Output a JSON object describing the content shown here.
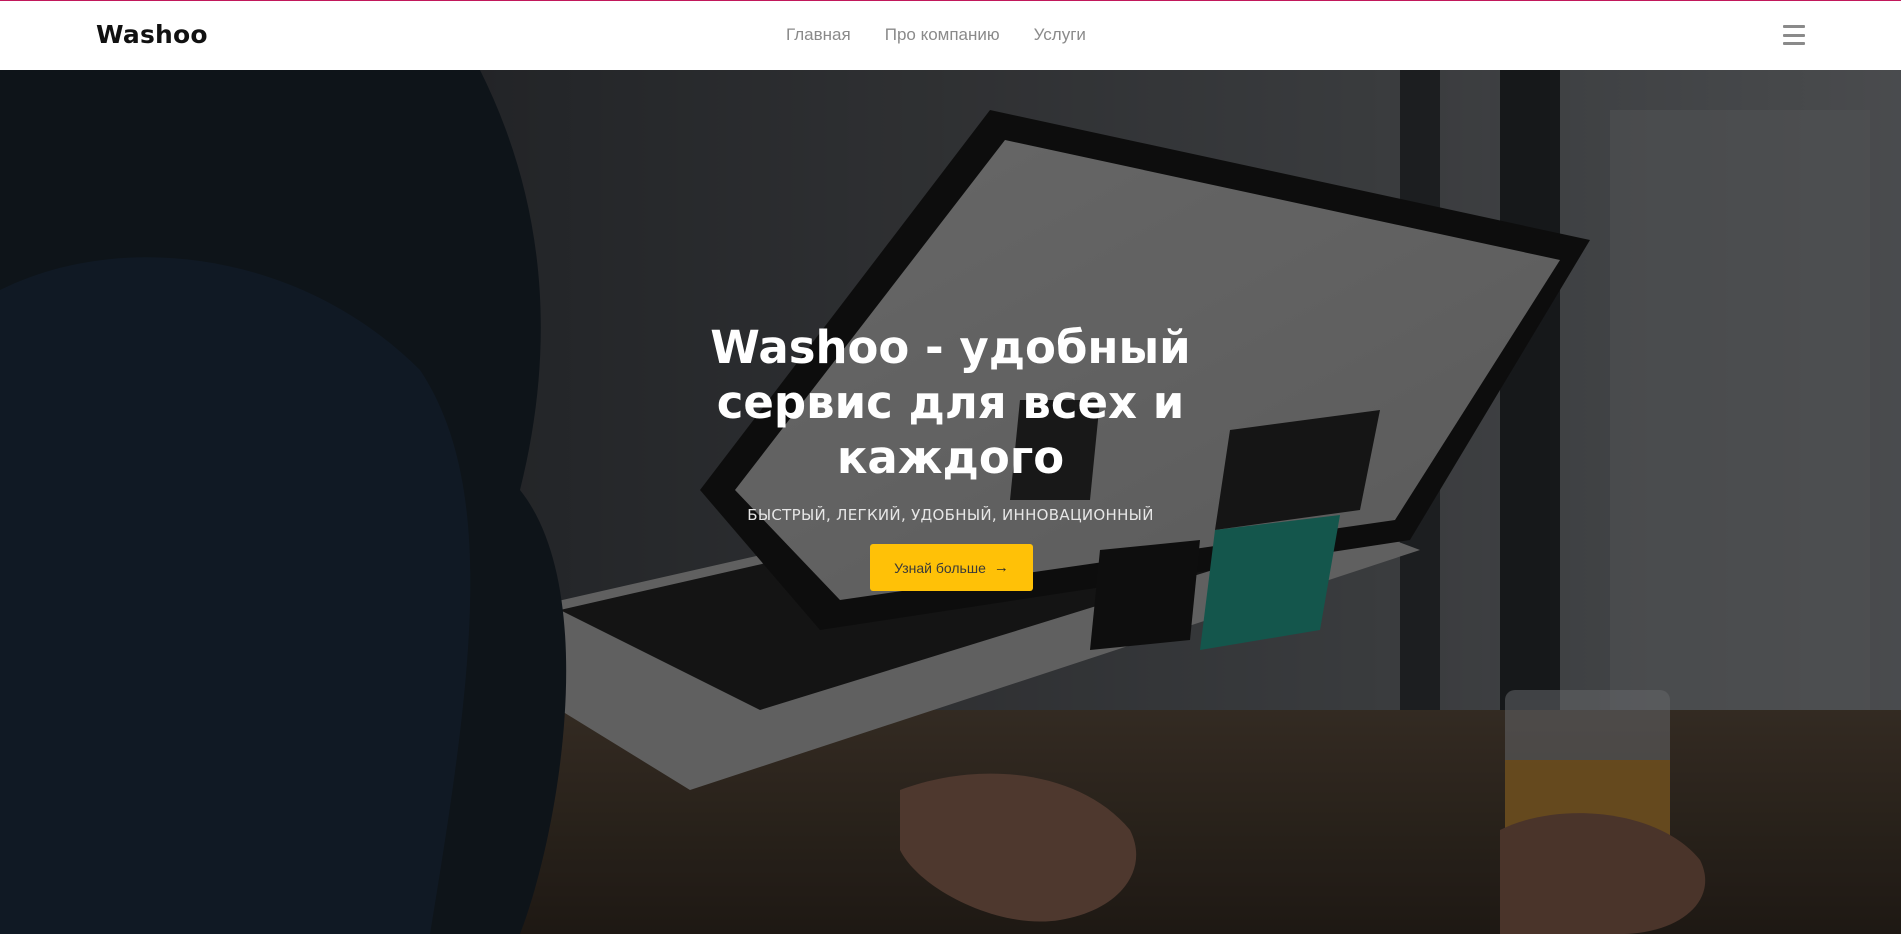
{
  "navbar": {
    "brand": "Washoo",
    "links": [
      {
        "label": "Главная"
      },
      {
        "label": "Про компанию"
      },
      {
        "label": "Услуги"
      }
    ],
    "menu_icon": "hamburger-menu-icon"
  },
  "hero": {
    "title": "Washoo - удобный сервис для всех и каждого",
    "subtitle": "БЫСТРЫЙ, ЛЕГКИЙ, УДОБНЫЙ, ИННОВАЦИОННЫЙ",
    "button_label": "Узнай больше",
    "button_icon": "arrow-right-icon",
    "background": "person-using-laptop-photo"
  },
  "colors": {
    "accent": "#ffc107",
    "top_border": "#c2185b",
    "nav_text": "#8a8a8a"
  }
}
